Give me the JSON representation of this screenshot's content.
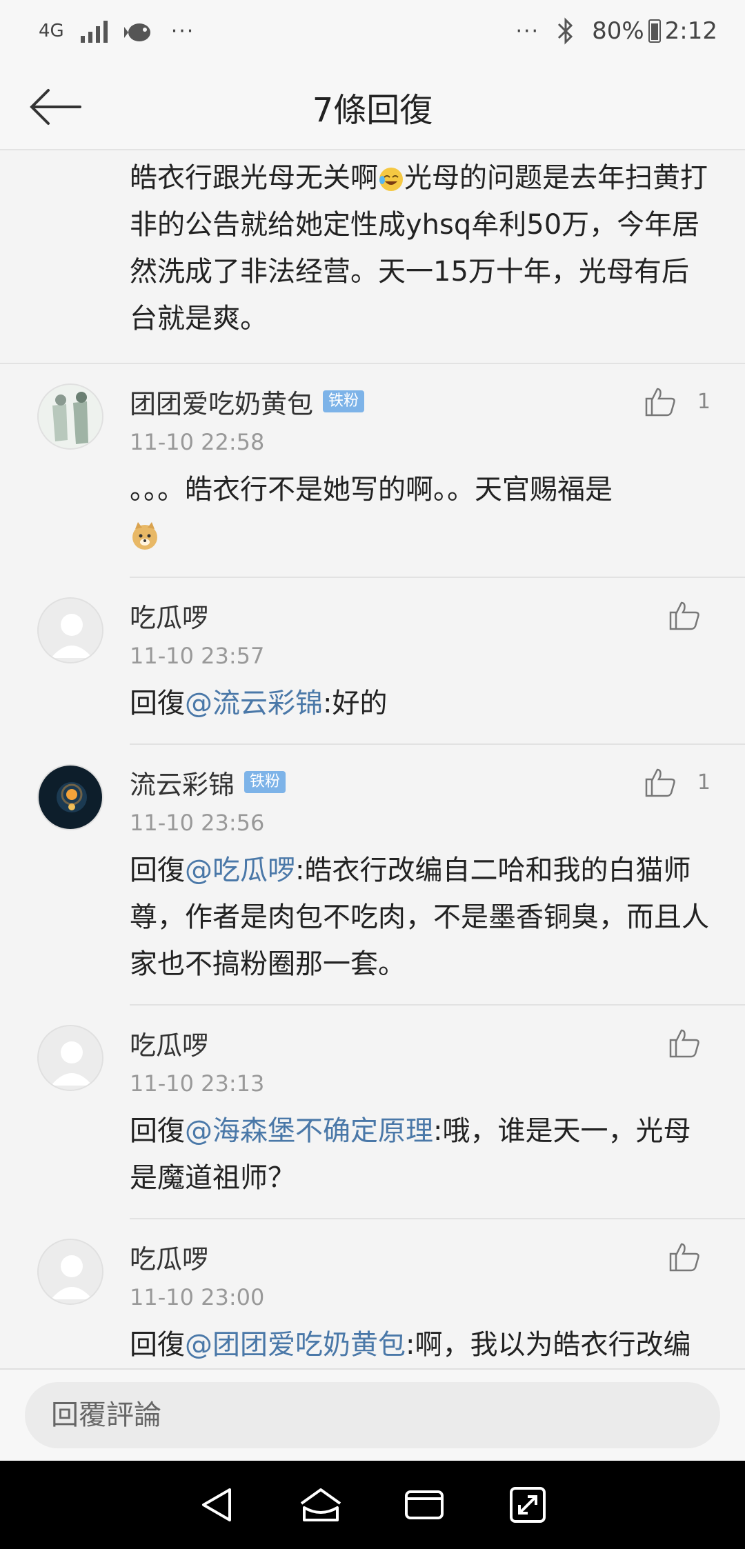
{
  "status": {
    "network": "4G",
    "battery": "80%",
    "time": "2:12",
    "more": "···"
  },
  "header": {
    "title": "7條回復"
  },
  "main_reply": {
    "text_a": "皓衣行跟光母无关啊",
    "text_b": "光母的问题是去年扫黄打非的公告就给她定性成yhsq牟利50万，今年居然洗成了非法经营。天一15万十年，光母有后台就是爽。"
  },
  "replies": [
    {
      "username": "团团爱吃奶黄包",
      "badge": "铁粉",
      "likes": "1",
      "time": "11-10 22:58",
      "text": "。。。皓衣行不是她写的啊。。天官赐福是"
    },
    {
      "username": "吃瓜啰",
      "time": "11-10 23:57",
      "prefix": "回復",
      "mention": "@流云彩锦",
      "text": ":好的"
    },
    {
      "username": "流云彩锦",
      "badge": "铁粉",
      "likes": "1",
      "time": "11-10 23:56",
      "prefix": "回復",
      "mention": "@吃瓜啰",
      "text": ":皓衣行改编自二哈和我的白猫师尊，作者是肉包不吃肉，不是墨香铜臭，而且人家也不搞粉圈那一套。"
    },
    {
      "username": "吃瓜啰",
      "time": "11-10 23:13",
      "prefix": "回復",
      "mention": "@海森堡不确定原理",
      "text": ":哦，谁是天一，光母是魔道祖师？"
    },
    {
      "username": "吃瓜啰",
      "time": "11-10 23:00",
      "prefix": "回復",
      "mention": "@团团爱吃奶黄包",
      "text": ":啊，我以为皓衣行改编的我的二狗师傅什么的，都是dg，搞混了"
    }
  ],
  "bottom": {
    "placeholder": "回覆評論"
  },
  "colors": {
    "mention": "#4a78a8",
    "badge": "#7db3e8",
    "background": "#f4f4f4"
  }
}
